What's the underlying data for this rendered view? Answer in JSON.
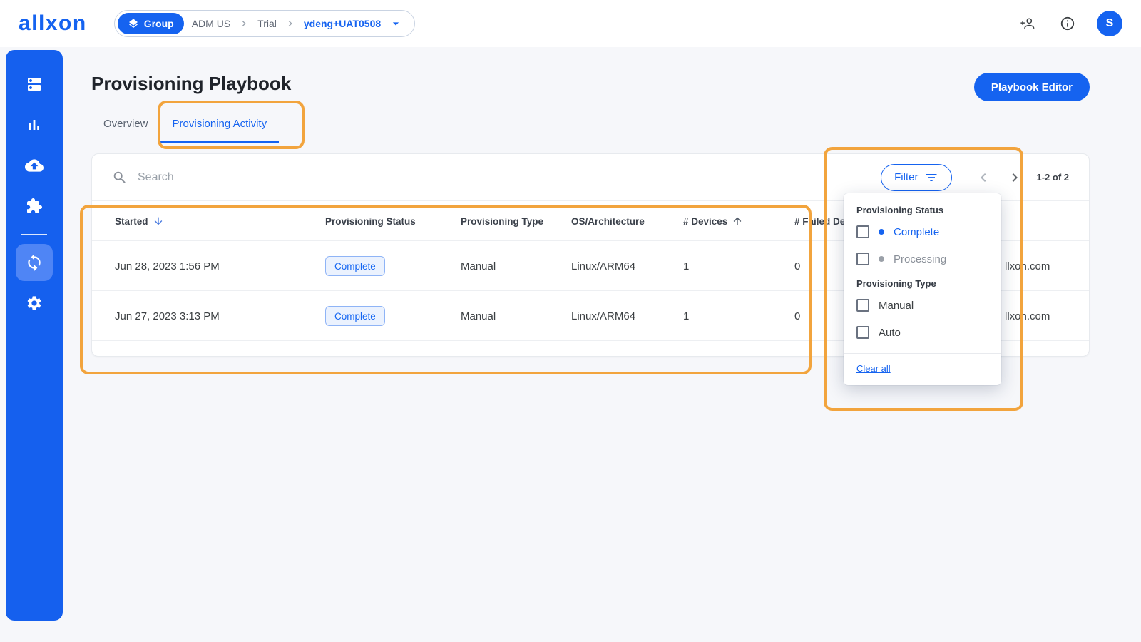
{
  "brand": {
    "logo": "allxon"
  },
  "topbar": {
    "breadcrumb": {
      "group_label": "Group",
      "org": "ADM US",
      "project": "Trial",
      "current": "ydeng+UAT0508"
    },
    "avatar_initial": "S"
  },
  "page": {
    "title": "Provisioning Playbook",
    "editor_button": "Playbook Editor",
    "tabs": [
      {
        "label": "Overview",
        "active": false
      },
      {
        "label": "Provisioning Activity",
        "active": true
      }
    ]
  },
  "toolbar": {
    "search_placeholder": "Search",
    "filter_label": "Filter",
    "pagination": "1-2 of 2"
  },
  "table": {
    "columns": [
      {
        "label": "Started",
        "sort": "desc"
      },
      {
        "label": "Provisioning Status",
        "sort": null
      },
      {
        "label": "Provisioning Type",
        "sort": null
      },
      {
        "label": "OS/Architecture",
        "sort": null
      },
      {
        "label": "# Devices",
        "sort": "asc"
      },
      {
        "label": "# Failed Devices",
        "sort": null
      }
    ],
    "rows": [
      {
        "started": "Jun 28, 2023 1:56 PM",
        "status": "Complete",
        "type": "Manual",
        "os": "Linux/ARM64",
        "devices": "1",
        "failed": "0",
        "operator": "llxon.com"
      },
      {
        "started": "Jun 27, 2023 3:13 PM",
        "status": "Complete",
        "type": "Manual",
        "os": "Linux/ARM64",
        "devices": "1",
        "failed": "0",
        "operator": "llxon.com"
      }
    ]
  },
  "filter_panel": {
    "status_section": "Provisioning Status",
    "type_section": "Provisioning Type",
    "options": {
      "complete": "Complete",
      "processing": "Processing",
      "manual": "Manual",
      "auto": "Auto"
    },
    "clear_all": "Clear all"
  },
  "colors": {
    "accent": "#1563F0",
    "sidebar": "#1560EE",
    "annotation": "#F2A43D",
    "chip_bg": "#EBF2FE",
    "chip_border": "#8FB4F6"
  },
  "icons": {
    "topbar": [
      "layers-icon",
      "person-add-icon",
      "info-icon"
    ],
    "sidebar": [
      "devices-icon",
      "analytics-icon",
      "cloud-upload-icon",
      "extensions-icon",
      "provisioning-icon",
      "settings-icon"
    ],
    "toolbar": [
      "search-icon",
      "filter-icon",
      "chevron-left-icon",
      "chevron-right-icon"
    ],
    "table": [
      "sort-desc-icon",
      "sort-asc-icon"
    ]
  }
}
